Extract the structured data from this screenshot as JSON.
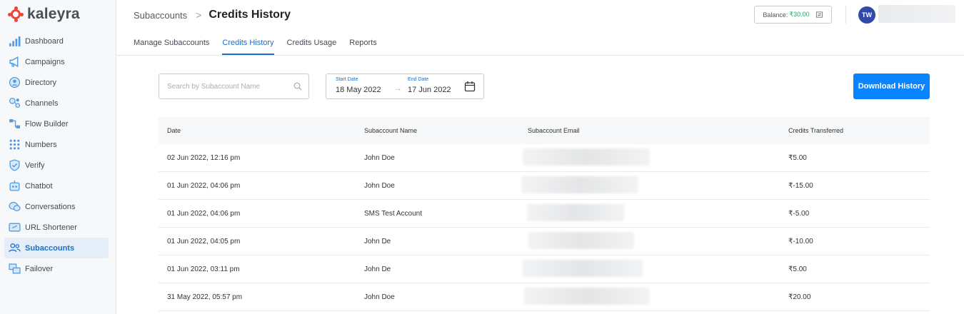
{
  "brand": {
    "name": "kaleyra",
    "accent": "#e8453c"
  },
  "sidebar": {
    "items": [
      {
        "label": "Dashboard",
        "icon": "bar-chart-icon",
        "active": false
      },
      {
        "label": "Campaigns",
        "icon": "megaphone-icon",
        "active": false
      },
      {
        "label": "Directory",
        "icon": "contact-icon",
        "active": false
      },
      {
        "label": "Channels",
        "icon": "channels-icon",
        "active": false
      },
      {
        "label": "Flow Builder",
        "icon": "flow-icon",
        "active": false
      },
      {
        "label": "Numbers",
        "icon": "numbers-grid-icon",
        "active": false
      },
      {
        "label": "Verify",
        "icon": "shield-check-icon",
        "active": false
      },
      {
        "label": "Chatbot",
        "icon": "robot-icon",
        "active": false
      },
      {
        "label": "Conversations",
        "icon": "chat-bubbles-icon",
        "active": false
      },
      {
        "label": "URL Shortener",
        "icon": "link-icon",
        "active": false
      },
      {
        "label": "Subaccounts",
        "icon": "users-icon",
        "active": true
      },
      {
        "label": "Failover",
        "icon": "failover-icon",
        "active": false
      }
    ]
  },
  "header": {
    "breadcrumb_parent": "Subaccounts",
    "breadcrumb_separator": ">",
    "title": "Credits History",
    "balance_label": "Balance:",
    "balance_amount": "₹30.00",
    "avatar_initials": "TW"
  },
  "tabs": [
    {
      "label": "Manage Subaccounts",
      "active": false
    },
    {
      "label": "Credits History",
      "active": true
    },
    {
      "label": "Credits Usage",
      "active": false
    },
    {
      "label": "Reports",
      "active": false
    }
  ],
  "filters": {
    "search_placeholder": "Search by Subaccount Name",
    "start_label": "Start Date",
    "start_value": "18 May 2022",
    "end_label": "End Date",
    "end_value": "17 Jun 2022",
    "download_label": "Download History"
  },
  "table": {
    "headers": [
      "Date",
      "Subaccount Name",
      "Subaccount Email",
      "Credits Transferred"
    ],
    "rows": [
      {
        "date": "02 Jun 2022, 12:16 pm",
        "name": "John Doe",
        "credits": "₹5.00"
      },
      {
        "date": "01 Jun 2022, 04:06 pm",
        "name": "John Doe",
        "credits": "₹-15.00"
      },
      {
        "date": "01 Jun 2022, 04:06 pm",
        "name": "SMS Test Account",
        "credits": "₹-5.00"
      },
      {
        "date": "01 Jun 2022, 04:05 pm",
        "name": "John De",
        "credits": "₹-10.00"
      },
      {
        "date": "01 Jun 2022, 03:11 pm",
        "name": "John De",
        "credits": "₹5.00"
      },
      {
        "date": "31 May 2022, 05:57 pm",
        "name": "John Doe",
        "credits": "₹20.00"
      }
    ]
  }
}
